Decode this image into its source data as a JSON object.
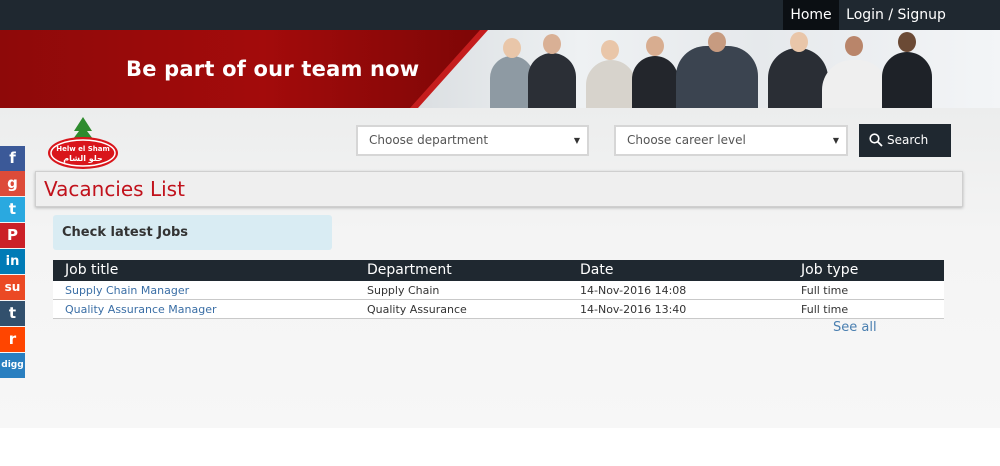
{
  "nav": {
    "home": "Home",
    "login": "Login / Signup"
  },
  "banner": {
    "headline": "Be part of our team now"
  },
  "logo": {
    "text_en": "Helw el Sham",
    "text_ar": "حلو الشام"
  },
  "filters": {
    "department_placeholder": "Choose department",
    "career_level_placeholder": "Choose career level",
    "search_label": "Search"
  },
  "page_title": "Vacancies List",
  "latest_label": "Check latest Jobs",
  "table": {
    "headers": [
      "Job title",
      "Department",
      "Date",
      "Job type"
    ],
    "rows": [
      [
        "Supply Chain Manager",
        "Supply Chain",
        "14-Nov-2016 14:08",
        "Full time"
      ],
      [
        "Quality Assurance Manager",
        "Quality Assurance",
        "14-Nov-2016 13:40",
        "Full time"
      ]
    ]
  },
  "see_all": "See all",
  "social": [
    {
      "name": "facebook-icon",
      "glyph": "f",
      "color": "#3b5998"
    },
    {
      "name": "google-plus-icon",
      "glyph": "g",
      "color": "#dd4b39"
    },
    {
      "name": "twitter-icon",
      "glyph": "t",
      "color": "#2aa9e0"
    },
    {
      "name": "pinterest-icon",
      "glyph": "P",
      "color": "#cb2027"
    },
    {
      "name": "linkedin-icon",
      "glyph": "in",
      "color": "#007bb6"
    },
    {
      "name": "stumbleupon-icon",
      "glyph": "su",
      "color": "#eb4924"
    },
    {
      "name": "tumblr-icon",
      "glyph": "t",
      "color": "#32506d"
    },
    {
      "name": "reddit-icon",
      "glyph": "r",
      "color": "#ff4500"
    },
    {
      "name": "digg-icon",
      "glyph": "digg",
      "color": "#2a7fc0"
    }
  ]
}
